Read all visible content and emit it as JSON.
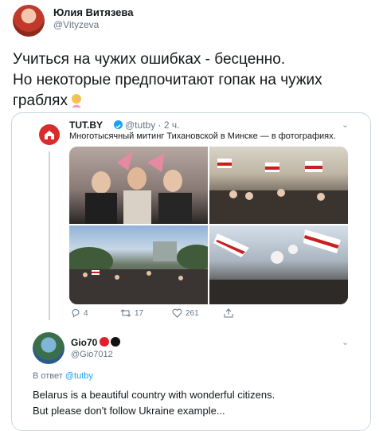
{
  "tweet": {
    "author_name": "Юлия Витязева",
    "author_handle": "@Vityzeva",
    "text_line1": "Учиться на чужих ошибках - бесценно.",
    "text_line2": "Но некоторые предпочитают гопак на чужих",
    "text_line3": "граблях"
  },
  "quoted": {
    "name": "TUT.BY",
    "handle_time": "@tutby · 2 ч.",
    "text": "Многотысячный митинг Тихановской в Минске — в фотографиях.",
    "replies": "4",
    "retweets": "17",
    "likes": "261",
    "icons": [
      "tutby-logo-icon",
      "verified-icon",
      "chevron-down-icon",
      "reply-icon",
      "retweet-icon",
      "like-icon",
      "share-icon"
    ]
  },
  "reply": {
    "name": "Gio70",
    "handle": "@Gio7012",
    "in_reply_prefix": "В ответ",
    "in_reply_handle": "@tutby",
    "text_line1": "Belarus is a beautiful country with wonderful citizens.",
    "text_line2": "But please don't follow Ukraine example..."
  },
  "colors": {
    "accent": "#1da1f2",
    "secondary_text": "#657786",
    "border": "#ccd6dd",
    "tutby_red": "#d92d2d"
  }
}
